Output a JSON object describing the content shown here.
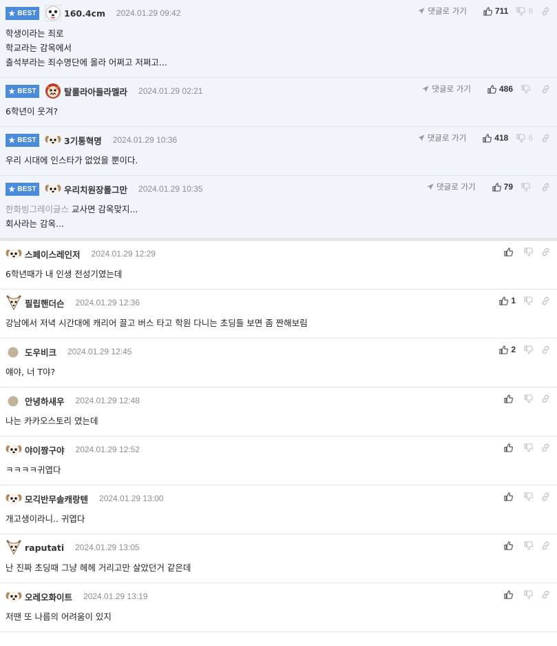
{
  "ui": {
    "best_label": "BEST",
    "goto_label": "댓글로 가기"
  },
  "comments": [
    {
      "best": true,
      "avatar": "bichon-face-icon",
      "nick": "160.4cm",
      "date": "2024.01.29 09:42",
      "up": "711",
      "down": "8",
      "lines": [
        "학생이라는 죄로",
        "학교라는 감옥에서",
        "출석부라는 죄수명단에 올라 어쩌고 저쩌고..."
      ],
      "mention": ""
    },
    {
      "best": true,
      "avatar": "beast-face-icon",
      "nick": "탈룰라아들라멜라",
      "date": "2024.01.29 02:21",
      "up": "486",
      "down": "",
      "lines": [
        "6학년이 웃겨?"
      ],
      "mention": ""
    },
    {
      "best": true,
      "avatar": "puppy-face-icon",
      "nick": "3기통혁명",
      "date": "2024.01.29 10:36",
      "up": "418",
      "down": "6",
      "lines": [
        "우리 시대에 인스타가 없었을 뿐이다."
      ],
      "mention": ""
    },
    {
      "best": true,
      "avatar": "puppy-face-icon",
      "nick": "우리치원장롤그만",
      "date": "2024.01.29 10:35",
      "up": "79",
      "down": "",
      "lines": [
        "교사면 감옥맞지...",
        "회사라는 감옥..."
      ],
      "mention": "한화빙그레이글스"
    },
    {
      "best": false,
      "avatar": "puppy-face-icon",
      "nick": "스페이스레인저",
      "date": "2024.01.29 12:29",
      "up": "",
      "down": "",
      "lines": [
        "6학년때가 내 인생 전성기였는데"
      ],
      "mention": ""
    },
    {
      "best": false,
      "avatar": "fox-face-icon",
      "nick": "필립핸더슨",
      "date": "2024.01.29 12:36",
      "up": "1",
      "down": "",
      "lines": [
        "강남에서 저녁 시간대에 캐리어 끌고 버스 타고 학원 다니는 초딩들 보면 좀 짠해보림"
      ],
      "mention": ""
    },
    {
      "best": false,
      "avatar": "default-avatar-icon",
      "nick": "도우비크",
      "date": "2024.01.29 12:45",
      "up": "2",
      "down": "",
      "lines": [
        "얘야, 너 T야?"
      ],
      "mention": ""
    },
    {
      "best": false,
      "avatar": "default-avatar-icon",
      "nick": "안녕하새우",
      "date": "2024.01.29 12:48",
      "up": "",
      "down": "",
      "lines": [
        "나는 카카오스토리 였는데"
      ],
      "mention": ""
    },
    {
      "best": false,
      "avatar": "puppy-face-icon",
      "nick": "야이짱구야",
      "date": "2024.01.29 12:52",
      "up": "",
      "down": "",
      "lines": [
        "ㅋㅋㅋㅋ귀엽다"
      ],
      "mention": ""
    },
    {
      "best": false,
      "avatar": "puppy-face-icon",
      "nick": "모긱반무솔캐랑텐",
      "date": "2024.01.29 13:00",
      "up": "",
      "down": "",
      "lines": [
        "개고생이라니.. 귀엽다"
      ],
      "mention": ""
    },
    {
      "best": false,
      "avatar": "fox-face-icon",
      "nick": "raputati",
      "date": "2024.01.29 13:05",
      "up": "",
      "down": "",
      "lines": [
        "난 진짜 초딩때 그냥 헤헤 거리고만 살았던거 같은데"
      ],
      "mention": ""
    },
    {
      "best": false,
      "avatar": "puppy-face-icon",
      "nick": "오레오화이트",
      "date": "2024.01.29 13:19",
      "up": "",
      "down": "",
      "lines": [
        "저땐 또 나름의 어려움이 있지"
      ],
      "mention": ""
    }
  ]
}
